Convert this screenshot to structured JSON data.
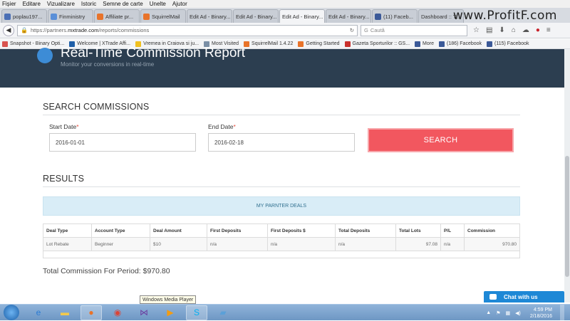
{
  "menu": [
    "Fișier",
    "Editare",
    "Vizualizare",
    "Istoric",
    "Semne de carte",
    "Unelte",
    "Ajutor"
  ],
  "tabs": [
    {
      "label": "poplau197...",
      "color": "#4a6fb5"
    },
    {
      "label": "Finministry",
      "color": "#5a8fd8"
    },
    {
      "label": "Affiliate pr...",
      "color": "#e8732a"
    },
    {
      "label": "SquirrelMail",
      "color": "#e8732a"
    },
    {
      "label": "Edit Ad - Binary...",
      "color": "#999999"
    },
    {
      "label": "Edit Ad - Binary...",
      "color": "#999999"
    },
    {
      "label": "Edit Ad - Binary...",
      "color": "#999999"
    },
    {
      "label": "Edit Ad - Binary...",
      "color": "#999999"
    },
    {
      "label": "(11) Faceb...",
      "color": "#3b5998"
    },
    {
      "label": "Dashboard :: T...",
      "color": "#999999"
    }
  ],
  "logo": {
    "pre": "ProfitF",
    "brand": "",
    "post": ".com",
    "prefix": "www."
  },
  "url": {
    "scheme": "https://partners.",
    "host": "mxtrade.com",
    "path": "/reports/commissions"
  },
  "search_placeholder": "Caută",
  "bookmarks": [
    {
      "label": "Snapshot - Binary Opti...",
      "color": "#d9534f"
    },
    {
      "label": "Welcome | XTrade Affi...",
      "color": "#1f5fa8"
    },
    {
      "label": "Vremea in Craiova si ju...",
      "color": "#f0c020"
    },
    {
      "label": "Most Visited",
      "color": "#7a8fa6"
    },
    {
      "label": "SquirrelMail 1.4.22",
      "color": "#e8732a"
    },
    {
      "label": "Getting Started",
      "color": "#e8732a"
    },
    {
      "label": "Gazeta Sporturilor :: GS...",
      "color": "#c9302c"
    },
    {
      "label": "More",
      "color": "#3b5998"
    },
    {
      "label": "(186) Facebook",
      "color": "#3b5998"
    },
    {
      "label": "(115) Facebook",
      "color": "#3b5998"
    }
  ],
  "hero": {
    "title": "Real-Time Commission Report",
    "subtitle": "Monitor your conversions in real-time"
  },
  "search_section": {
    "title": "SEARCH COMMISSIONS",
    "start_label": "Start Date",
    "start_value": "2016-01-01",
    "end_label": "End Date",
    "end_value": "2016-02-18",
    "button": "SEARCH"
  },
  "results": {
    "title": "RESULTS",
    "deals_label": "MY PARNTER DEALS",
    "columns": [
      "Deal Type",
      "Account Type",
      "Deal Amount",
      "First Deposits",
      "First Deposits $",
      "Total Deposits",
      "Total Lots",
      "P/L",
      "Commission"
    ],
    "rows": [
      [
        "Lot Rebate",
        "Beginner",
        "$10",
        "n/a",
        "n/a",
        "n/a",
        "97.08",
        "n/a",
        "970.80"
      ]
    ],
    "total": "Total Commission For Period: $970.80"
  },
  "chat": "Chat with us",
  "tooltip": "Windows Media Player",
  "clock": {
    "time": "4:59 PM",
    "date": "2/18/2016"
  }
}
